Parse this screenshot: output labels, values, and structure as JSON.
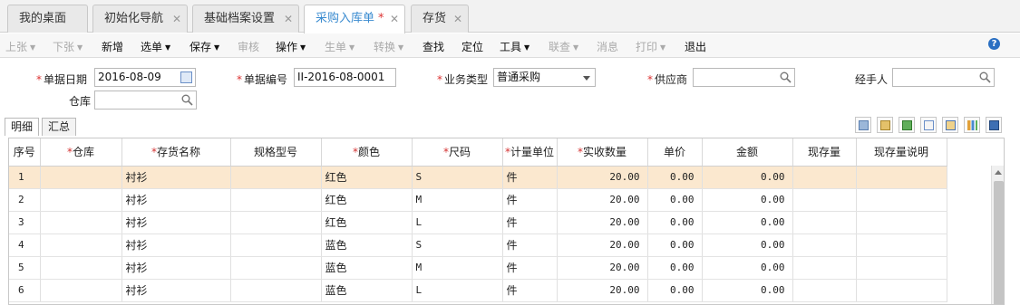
{
  "tabs": [
    {
      "label": "我的桌面",
      "closable": false
    },
    {
      "label": "初始化导航",
      "closable": true
    },
    {
      "label": "基础档案设置",
      "closable": true
    },
    {
      "label": "采购入库单",
      "closable": true,
      "active": true,
      "modified_mark": "*"
    },
    {
      "label": "存货",
      "closable": true
    }
  ],
  "toolbar": {
    "prev": "上张",
    "next": "下张",
    "new": "新增",
    "select": "选单",
    "save": "保存",
    "audit": "审核",
    "operate": "操作",
    "generate": "生单",
    "convert": "转换",
    "find": "查找",
    "locate": "定位",
    "tools": "工具",
    "linked_query": "联查",
    "message": "消息",
    "print": "打印",
    "exit": "退出",
    "help": "?"
  },
  "form": {
    "date_label": "单据日期",
    "date_value": "2016-08-09",
    "number_label": "单据编号",
    "number_value": "II-2016-08-0001",
    "biz_type_label": "业务类型",
    "biz_type_value": "普通采购",
    "supplier_label": "供应商",
    "supplier_value": "",
    "handler_label": "经手人",
    "handler_value": "",
    "warehouse_label": "仓库",
    "warehouse_value": "",
    "required_mark": "*"
  },
  "subtabs": {
    "detail": "明细",
    "summary": "汇总"
  },
  "grid": {
    "columns": [
      "序号",
      "仓库",
      "存货名称",
      "规格型号",
      "颜色",
      "尺码",
      "计量单位",
      "实收数量",
      "单价",
      "金额",
      "现存量",
      "现存量说明"
    ],
    "required_columns": [
      1,
      2,
      4,
      5,
      6,
      7
    ],
    "rows": [
      {
        "idx": "1",
        "warehouse": "",
        "name": "衬衫",
        "spec": "",
        "color": "红色",
        "size": "S",
        "unit": "件",
        "qty": "20.00",
        "price": "0.00",
        "amount": "0.00",
        "stock": "",
        "stock_note": ""
      },
      {
        "idx": "2",
        "warehouse": "",
        "name": "衬衫",
        "spec": "",
        "color": "红色",
        "size": "M",
        "unit": "件",
        "qty": "20.00",
        "price": "0.00",
        "amount": "0.00",
        "stock": "",
        "stock_note": ""
      },
      {
        "idx": "3",
        "warehouse": "",
        "name": "衬衫",
        "spec": "",
        "color": "红色",
        "size": "L",
        "unit": "件",
        "qty": "20.00",
        "price": "0.00",
        "amount": "0.00",
        "stock": "",
        "stock_note": ""
      },
      {
        "idx": "4",
        "warehouse": "",
        "name": "衬衫",
        "spec": "",
        "color": "蓝色",
        "size": "S",
        "unit": "件",
        "qty": "20.00",
        "price": "0.00",
        "amount": "0.00",
        "stock": "",
        "stock_note": ""
      },
      {
        "idx": "5",
        "warehouse": "",
        "name": "衬衫",
        "spec": "",
        "color": "蓝色",
        "size": "M",
        "unit": "件",
        "qty": "20.00",
        "price": "0.00",
        "amount": "0.00",
        "stock": "",
        "stock_note": ""
      },
      {
        "idx": "6",
        "warehouse": "",
        "name": "衬衫",
        "spec": "",
        "color": "蓝色",
        "size": "L",
        "unit": "件",
        "qty": "20.00",
        "price": "0.00",
        "amount": "0.00",
        "stock": "",
        "stock_note": ""
      }
    ]
  },
  "colors": {
    "accent": "#3a8bd0",
    "required": "#d33333",
    "selected_row": "#fbe8cf"
  },
  "icons": [
    "copy-icon",
    "paste-icon",
    "excel-icon",
    "preview-icon",
    "export-icon",
    "chart-icon",
    "save-disk-icon"
  ]
}
